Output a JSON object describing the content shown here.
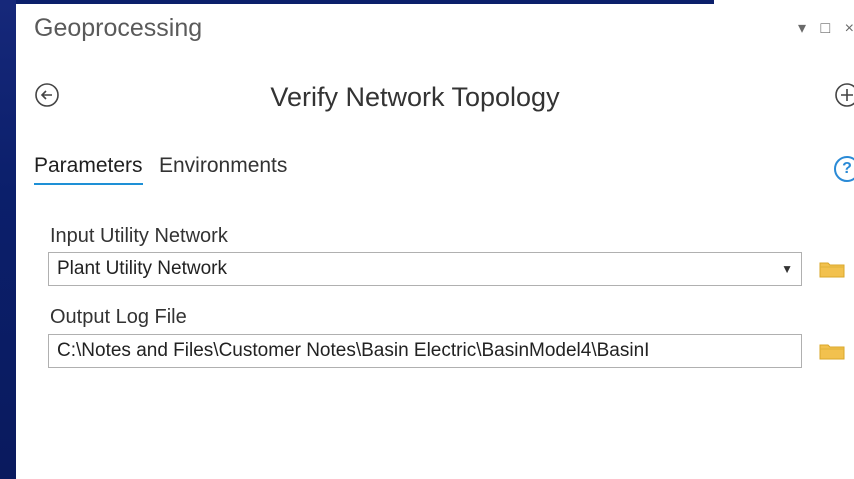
{
  "pane": {
    "title": "Geoprocessing",
    "controls": [
      "▾",
      "□",
      "×"
    ]
  },
  "tool": {
    "title": "Verify Network Topology"
  },
  "tabs": [
    {
      "label": "Parameters",
      "active": true
    },
    {
      "label": "Environments",
      "active": false
    }
  ],
  "params": [
    {
      "label": "Input Utility Network",
      "value": "Plant Utility Network",
      "type": "dropdown"
    },
    {
      "label": "Output Log File",
      "value": "C:\\Notes and Files\\Customer Notes\\Basin Electric\\BasinModel4\\BasinI",
      "type": "text"
    }
  ],
  "help_glyph": "?",
  "colors": {
    "background": "#0b1f6b",
    "accent": "#1e90d6",
    "folder": "#f2c14e"
  }
}
